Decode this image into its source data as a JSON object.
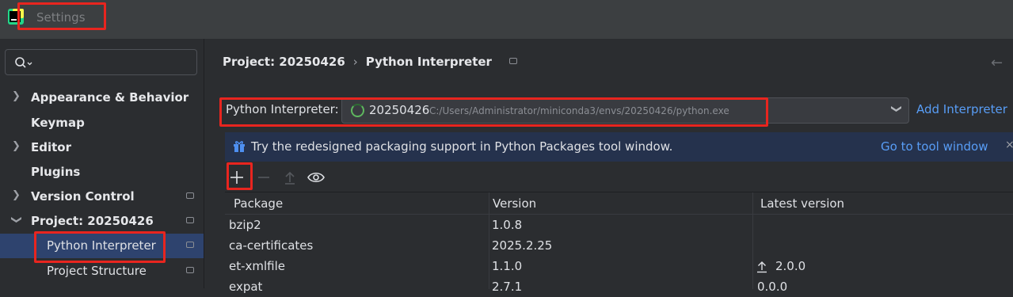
{
  "window": {
    "title": "Settings"
  },
  "sidebar": {
    "search_placeholder": "",
    "items": [
      {
        "label": "Appearance & Behavior",
        "expandable": true,
        "bold": true
      },
      {
        "label": "Keymap",
        "expandable": false,
        "bold": true
      },
      {
        "label": "Editor",
        "expandable": true,
        "bold": true
      },
      {
        "label": "Plugins",
        "expandable": false,
        "bold": true
      },
      {
        "label": "Version Control",
        "expandable": true,
        "bold": true,
        "project_icon": true
      },
      {
        "label": "Project: 20250426",
        "expanded": true,
        "bold": true,
        "project_icon": true
      },
      {
        "label": "Python Interpreter",
        "selected": true,
        "project_icon": true
      },
      {
        "label": "Project Structure",
        "project_icon": true
      }
    ]
  },
  "breadcrumb": {
    "project": "Project: 20250426",
    "separator": "›",
    "page": "Python Interpreter"
  },
  "interpreter": {
    "label": "Python Interpreter:",
    "env_name": "20250426",
    "env_path": "C:/Users/Administrator/miniconda3/envs/20250426/python.exe",
    "add_label": "Add Interpreter"
  },
  "banner": {
    "text": "Try the redesigned packaging support in Python Packages tool window.",
    "link": "Go to tool window",
    "close": "×"
  },
  "toolbar": {
    "add_icon": "plus-icon",
    "remove_icon": "minus-icon",
    "upgrade_icon": "upgrade-arrow-icon",
    "show_icon": "eye-icon"
  },
  "table": {
    "columns": [
      "Package",
      "Version",
      "Latest version"
    ],
    "rows": [
      {
        "package": "bzip2",
        "version": "1.0.8",
        "latest": ""
      },
      {
        "package": "ca-certificates",
        "version": "2025.2.25",
        "latest": ""
      },
      {
        "package": "et-xmlfile",
        "version": "1.1.0",
        "latest": "2.0.0",
        "upgrade": true
      },
      {
        "package": "expat",
        "version": "2.7.1",
        "latest": "0.0.0"
      }
    ]
  },
  "colors": {
    "accent": "#589df6",
    "selection": "#2e436e",
    "highlight": "#e8251f",
    "banner": "#25324d"
  }
}
